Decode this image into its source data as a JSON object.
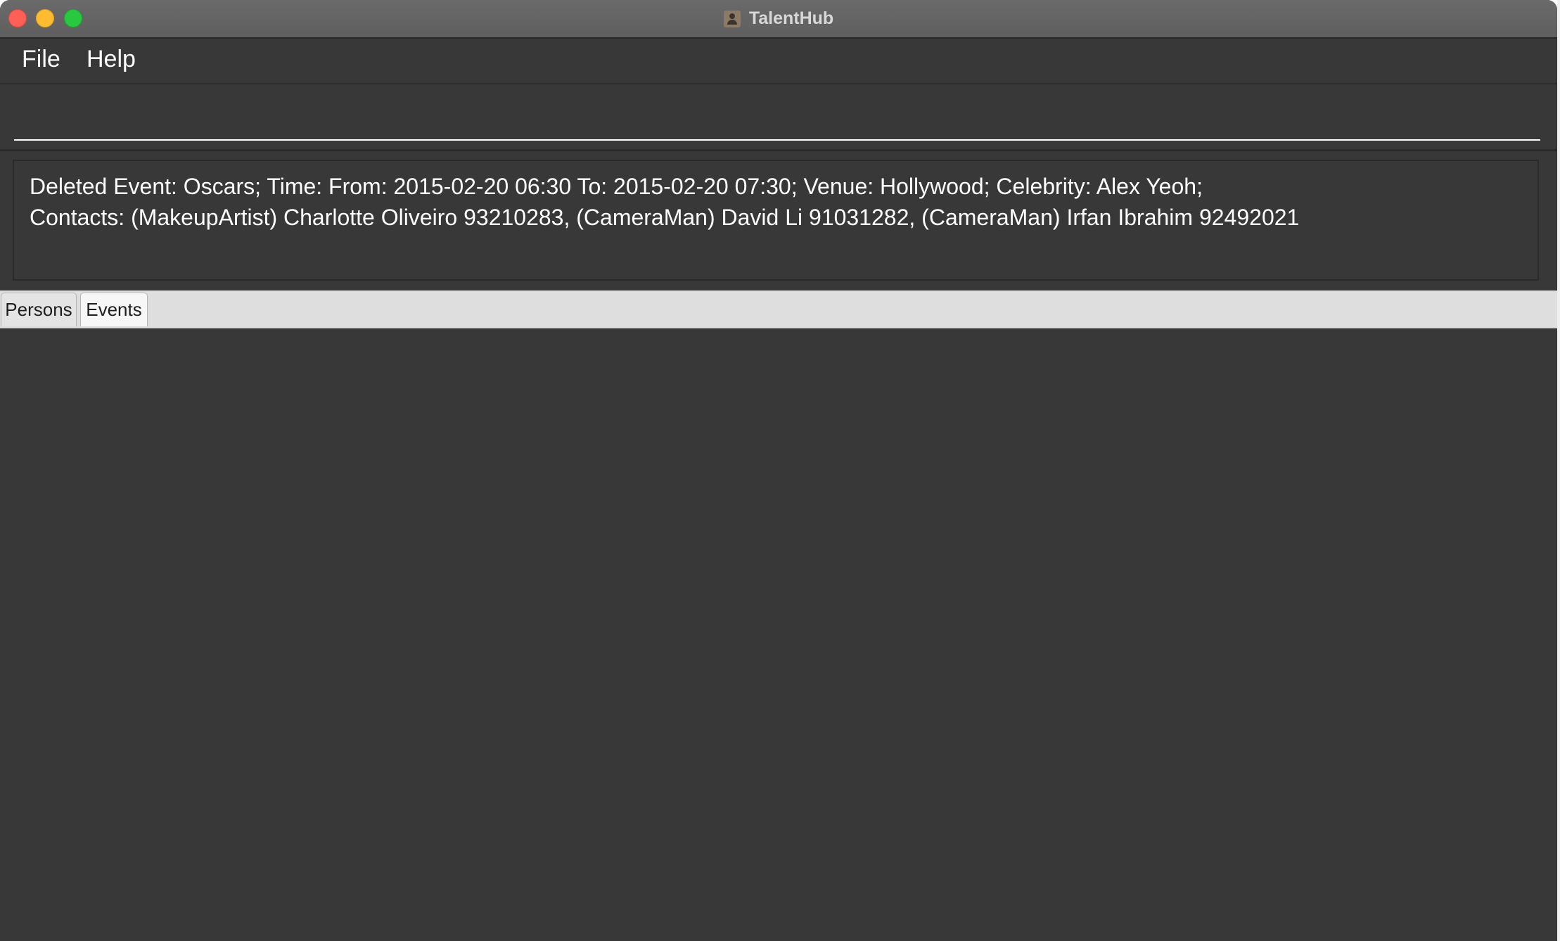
{
  "window": {
    "title": "TalentHub",
    "app_icon": "contact-card-icon"
  },
  "menu": {
    "items": [
      {
        "label": "File"
      },
      {
        "label": "Help"
      }
    ]
  },
  "command_box": {
    "value": "",
    "placeholder": ""
  },
  "result_display": {
    "line1": "Deleted Event: Oscars; Time: From: 2015-02-20 06:30 To: 2015-02-20 07:30; Venue: Hollywood; Celebrity: Alex Yeoh;",
    "line2": "Contacts: (MakeupArtist) Charlotte Oliveiro 93210283, (CameraMan) David Li 91031282, (CameraMan) Irfan Ibrahim 92492021"
  },
  "tabs": {
    "items": [
      {
        "label": "Persons"
      },
      {
        "label": "Events"
      }
    ],
    "selected": "Events"
  },
  "colors": {
    "background": "#383838",
    "titlebar": "#636363",
    "tabbar": "#dedede",
    "text": "#ffffff"
  }
}
